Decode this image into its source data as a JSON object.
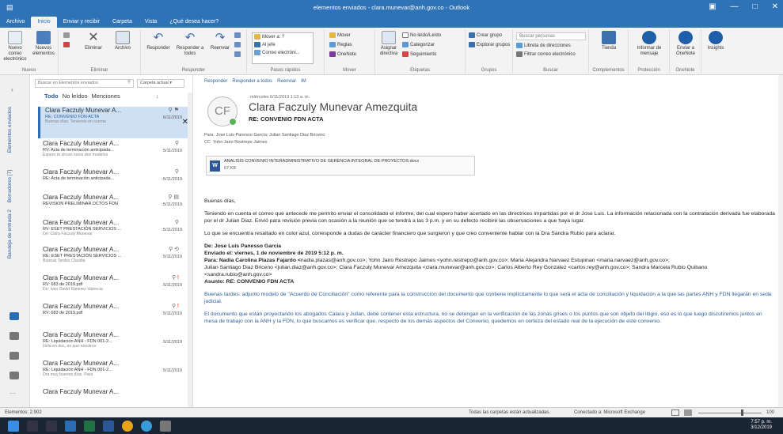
{
  "window": {
    "title": "elementos enviados - clara.munevar@anh.gov.co - Outlook"
  },
  "ribbon_tabs": [
    "Archivo",
    "Inicio",
    "Enviar y recibir",
    "Carpeta",
    "Vista",
    "¿Qué desea hacer?"
  ],
  "ribbon": {
    "nuevo": {
      "new_mail": "Nuevo correo electrónico",
      "new_items": "Nuevos elementos",
      "label": "Nuevo"
    },
    "eliminar": {
      "delete": "Eliminar",
      "archive": "Archivo",
      "label": "Eliminar"
    },
    "responder": {
      "reply": "Responder",
      "reply_all": "Responder a todos",
      "forward": "Reenviar",
      "label": "Responder"
    },
    "pasos": {
      "items": [
        "Mover a: ?",
        "Al jefe",
        "Correo electróni..."
      ],
      "label": "Pasos rápidos"
    },
    "mover": {
      "move": "Mover",
      "rules": "Reglas",
      "onenote": "OneNote",
      "label": "Mover"
    },
    "etiquetas": {
      "unread": "No leído/Leído",
      "categorize": "Categorizar",
      "followup": "Seguimiento",
      "assign": "Asignar directiva",
      "label": "Etiquetas"
    },
    "grupos": {
      "new_group": "Crear grupo",
      "browse": "Explorar grupos",
      "label": "Grupos"
    },
    "buscar": {
      "search_people": "Buscar personas",
      "address_book": "Libreta de direcciones",
      "filter": "Filtrar correo electrónico",
      "label": "Buscar"
    },
    "complementos": {
      "store": "Tienda",
      "label": "Complementos"
    },
    "proteccion": {
      "report": "Informar de mensaje",
      "label": "Protección"
    },
    "onenote": {
      "send": "Enviar a OneNote",
      "label": "OneNote"
    },
    "insights": "Insights"
  },
  "left_rail": {
    "sections": [
      "Elementos enviados",
      "Borradores [7]",
      "Bandeja de entrada 2"
    ]
  },
  "list": {
    "search_placeholder": "Buscar en Elementos enviados",
    "scope": "Carpeta actual",
    "filters": [
      "Todo",
      "No leídos",
      "Menciones"
    ],
    "messages": [
      {
        "from": "Clara Faczuly Munevar A...",
        "subject": "RE: CONVENIO FDN ACTA",
        "preview": "Buenas días,  Teniendo en cuenta",
        "date": "6/11/2019"
      },
      {
        "from": "Clara Faczuly Munevar A...",
        "subject": "RV: Acta de terminación anticipada...",
        "preview": "Espero te sirvan estos dos modelos",
        "date": "5/11/2019"
      },
      {
        "from": "Clara Faczuly Munevar A...",
        "subject": "RE: Acta de terminación anticipada...",
        "preview": "",
        "date": "5/11/2019"
      },
      {
        "from": "Clara Faczuly Munevar A...",
        "subject": "REVISION PRELIMINAR DCTOS FDN",
        "preview": "",
        "date": "5/11/2019"
      },
      {
        "from": "Clara Faczuly Munevar A...",
        "subject": "RV: ESET PRESTACIÓN SERVICIOS ...",
        "preview": "De: Clara Faczuly Munevar",
        "date": "5/11/2019"
      },
      {
        "from": "Clara Faczuly Munevar A...",
        "subject": "RE: ESET PRESTACIÓN SERVICIOS ...",
        "preview": "Buenas Tardes Claudia",
        "date": "5/11/2019"
      },
      {
        "from": "Clara Faczuly Munevar A...",
        "subject": "RV: 683 de 2019.pdf",
        "preview": "De: Ivan David Ramirez Valencia",
        "date": "5/11/2019"
      },
      {
        "from": "Clara Faczuly Munevar A...",
        "subject": "RV: 683 de 2019.pdf",
        "preview": "",
        "date": "5/11/2019"
      },
      {
        "from": "Clara Faczuly Munevar A...",
        "subject": "RE: Liquidación ANH - FDN 001-2...",
        "preview": "Hola  en doc, es que nosotros",
        "date": "5/11/2019"
      },
      {
        "from": "Clara Faczuly Munevar A...",
        "subject": "RE: Liquidación ANH - FDN 001-2...",
        "preview": "Dra muy buenos días. Para",
        "date": "5/11/2019"
      },
      {
        "from": "Clara Faczuly Munevar A...",
        "subject": "",
        "preview": "",
        "date": ""
      }
    ]
  },
  "reading": {
    "toolbar": [
      "Responder",
      "Responder a todos",
      "Reenviar",
      "IM"
    ],
    "avatar_initials": "CF",
    "timestamp": "miércoles 6/11/2019 1:13 a. m.",
    "sender": "Clara Faczuly Munevar Amezquita",
    "subject": "RE: CONVENIO FDN ACTA",
    "to_label": "Para",
    "to": "Jose Luis Panesso García;  Julian Santiago Diaz Briceno",
    "cc_label": "CC",
    "cc": "Yohn Jairo Restrepo Jaimes",
    "attachment": {
      "name": "ANALISIS CONVENIO INTERADMINISTRATIVO DE GERENCIA INTEGRAL DE PROYECTOS.docx",
      "size": "67 KB"
    },
    "greeting": "Buenas días,",
    "p1": "Teniendo en cuenta el correo que antecede me permito enviar el consolidado el informe, del cual espero haber acertado en las directrices impartidas por el dr Jose Luis. La información relacionada con la contratación derivada  fue elaborada por el dr Julian Diaz.  Envió para revisión previa con ocasión a la reunión que se tendrá a las 3 p.m. y en su defecto recibiré las observaciones a que haya lugar.",
    "p2": "Lo que se encuentra resaltado en color azul, corresponde a dudas de carácter financiero que surgieron y que creo conveniente hablar con la Dra Sandra Rubio para aclarar.",
    "fw": {
      "from": "De: Jose Luis Panesso Garcia",
      "sent": "Enviado el: viernes, 1 de noviembre de 2019 5:12 p. m.",
      "to_prefix": "Para: Nadia Carolina Plazas Fajardo <",
      "to_rest": "Julian Santiago Diaz Briceno <julian.diaz@anh.gov.co>; Clara Faczuly Munevar Amezquita <clara.munevar@anh.gov.co>; Carlos Alberto Rey Gonzalez <carlos.rey@anh.gov.co>; Sandra Marcela Rubio Quibano <sandra.rubio@anh.gov.co>",
      "line1": "nadia.plazas@anh.gov.co>; Yohn Jairo Restrepo Jaimes <yohn.restrepo@anh.gov.co>; Maria Alejandra Narvaez Estupinan <maria.narvaez@anh.gov.co>;",
      "subject": "Asunto: RE: CONVENIO FDN ACTA"
    },
    "p3": "Buenas tardes: adjunto modelo de \"Acuerdo de Conciliación\" como referente para la construcción del documento que contiene implícitamente lo que será el acta de conciliación y liquidación a la que las partes ANH y FDN llegarán en sede judicial.",
    "p4": "El documento que están proyectando los abogados Calara y Julian, debe contener esta estructura, no se detengan en la verificación de las zonas grises o los puntos que son objeto del litigio, eso es lo que luego discutiremos juntos en mesa de trabajo con la ANH y la FDN, lo que buscamos es verificar que, respecto de los demás aspectos del Convenio, quedemos en certeza del estado real de la ejecución de este convenio."
  },
  "status": {
    "items": "Elementos: 2.902",
    "sync": "Todas las carpetas están actualizadas.",
    "connected": "Conectado a: Microsoft Exchange",
    "zoom": "100"
  },
  "clock": {
    "time": "7:57 p. m.",
    "date": "3/12/2019"
  },
  "colors": {
    "accent": "#2f73b7",
    "selected": "#cde0f4",
    "link": "#1a5ea8"
  }
}
